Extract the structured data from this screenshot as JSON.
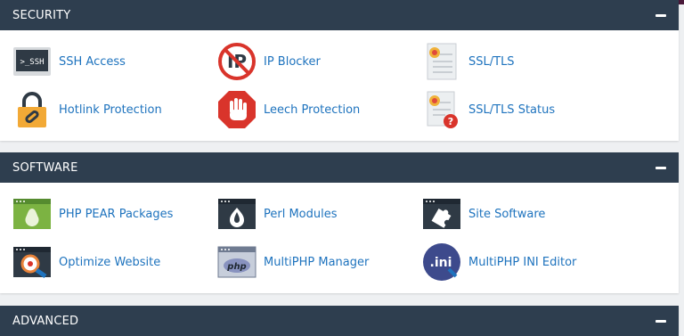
{
  "sections": [
    {
      "title": "SECURITY",
      "items": [
        {
          "label": "SSH Access",
          "icon": "terminal-ssh-icon"
        },
        {
          "label": "IP Blocker",
          "icon": "ip-blocker-icon"
        },
        {
          "label": "SSL/TLS",
          "icon": "certificate-icon"
        },
        {
          "label": "Hotlink Protection",
          "icon": "padlock-link-icon"
        },
        {
          "label": "Leech Protection",
          "icon": "stop-hand-icon"
        },
        {
          "label": "SSL/TLS Status",
          "icon": "certificate-status-icon"
        }
      ]
    },
    {
      "title": "SOFTWARE",
      "items": [
        {
          "label": "PHP PEAR Packages",
          "icon": "pear-icon"
        },
        {
          "label": "Perl Modules",
          "icon": "onion-icon"
        },
        {
          "label": "Site Software",
          "icon": "puzzle-icon"
        },
        {
          "label": "Optimize Website",
          "icon": "magnifier-icon"
        },
        {
          "label": "MultiPHP Manager",
          "icon": "php-icon"
        },
        {
          "label": "MultiPHP INI Editor",
          "icon": "ini-icon"
        }
      ]
    },
    {
      "title": "ADVANCED",
      "items": []
    }
  ],
  "ssh_icon_text": ">_SSH",
  "ip_icon_text": "IP",
  "php_icon_text": "php",
  "ini_icon_text": ".ini",
  "colors": {
    "header_bg": "#2e3e4f",
    "link": "#1e73be",
    "page_bg": "#eef0f2"
  }
}
